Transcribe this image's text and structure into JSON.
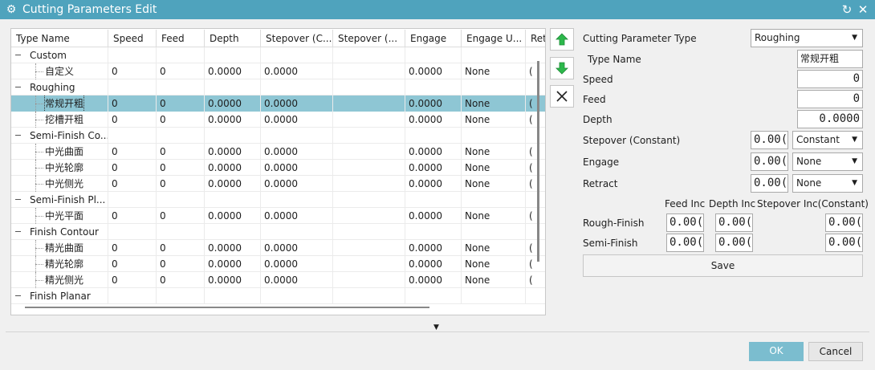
{
  "window": {
    "title": "Cutting Parameters Edit",
    "refresh_glyph": "↻",
    "close_glyph": "✕"
  },
  "colors": {
    "titlebar": "#4fa3bd",
    "selected_row": "#8ec6d4",
    "ok_button": "#7bbdcf",
    "up_arrow": "#2cb84b",
    "down_arrow": "#2cb84b"
  },
  "table": {
    "columns": [
      "Type Name",
      "Speed",
      "Feed",
      "Depth",
      "Stepover (C...",
      "Stepover (...",
      "Engage",
      "Engage U...",
      "Ret"
    ],
    "rows": [
      {
        "level": 0,
        "cells": [
          "Custom",
          "",
          "",
          "",
          "",
          "",
          "",
          "",
          ""
        ]
      },
      {
        "level": 1,
        "cells": [
          "自定义",
          "0",
          "0",
          "0.0000",
          "0.0000",
          "",
          "0.0000",
          "None",
          "("
        ]
      },
      {
        "level": 0,
        "cells": [
          "Roughing",
          "",
          "",
          "",
          "",
          "",
          "",
          "",
          ""
        ]
      },
      {
        "level": 1,
        "selected": true,
        "cells": [
          "常规开粗",
          "0",
          "0",
          "0.0000",
          "0.0000",
          "",
          "0.0000",
          "None",
          "("
        ]
      },
      {
        "level": 1,
        "cells": [
          "挖槽开粗",
          "0",
          "0",
          "0.0000",
          "0.0000",
          "",
          "0.0000",
          "None",
          "("
        ]
      },
      {
        "level": 0,
        "cells": [
          "Semi-Finish Co...",
          "",
          "",
          "",
          "",
          "",
          "",
          "",
          ""
        ]
      },
      {
        "level": 1,
        "cells": [
          "中光曲面",
          "0",
          "0",
          "0.0000",
          "0.0000",
          "",
          "0.0000",
          "None",
          "("
        ]
      },
      {
        "level": 1,
        "cells": [
          "中光轮廓",
          "0",
          "0",
          "0.0000",
          "0.0000",
          "",
          "0.0000",
          "None",
          "("
        ]
      },
      {
        "level": 1,
        "cells": [
          "中光侧光",
          "0",
          "0",
          "0.0000",
          "0.0000",
          "",
          "0.0000",
          "None",
          "("
        ]
      },
      {
        "level": 0,
        "cells": [
          "Semi-Finish Pl...",
          "",
          "",
          "",
          "",
          "",
          "",
          "",
          ""
        ]
      },
      {
        "level": 1,
        "cells": [
          "中光平面",
          "0",
          "0",
          "0.0000",
          "0.0000",
          "",
          "0.0000",
          "None",
          "("
        ]
      },
      {
        "level": 0,
        "cells": [
          "Finish Contour",
          "",
          "",
          "",
          "",
          "",
          "",
          "",
          ""
        ]
      },
      {
        "level": 1,
        "cells": [
          "精光曲面",
          "0",
          "0",
          "0.0000",
          "0.0000",
          "",
          "0.0000",
          "None",
          "("
        ]
      },
      {
        "level": 1,
        "cells": [
          "精光轮廓",
          "0",
          "0",
          "0.0000",
          "0.0000",
          "",
          "0.0000",
          "None",
          "("
        ]
      },
      {
        "level": 1,
        "cells": [
          "精光侧光",
          "0",
          "0",
          "0.0000",
          "0.0000",
          "",
          "0.0000",
          "None",
          "("
        ]
      },
      {
        "level": 0,
        "cells": [
          "Finish Planar",
          "",
          "",
          "",
          "",
          "",
          "",
          "",
          ""
        ]
      }
    ]
  },
  "side_buttons": {
    "move_up_icon": "arrow-up",
    "move_down_icon": "arrow-down",
    "delete_icon": "x"
  },
  "form": {
    "cutting_parameter_type_label": "Cutting Parameter Type",
    "cutting_parameter_type_value": "Roughing",
    "type_name_label": "Type Name",
    "type_name_value": "常规开粗",
    "speed_label": "Speed",
    "speed_value": "0",
    "feed_label": "Feed",
    "feed_value": "0",
    "depth_label": "Depth",
    "depth_value": "0.0000",
    "stepover_label": "Stepover (Constant)",
    "stepover_value": "0.00(",
    "stepover_mode": "Constant",
    "engage_label": "Engage",
    "engage_value": "0.00(",
    "engage_mode": "None",
    "retract_label": "Retract",
    "retract_value": "0.00(",
    "retract_mode": "None",
    "inc_header_feed": "Feed Inc",
    "inc_header_depth": "Depth Inc",
    "inc_header_stepover": "Stepover Inc(Constant)",
    "rough_finish_label": "Rough-Finish",
    "rough_finish_feed": "0.00(",
    "rough_finish_depth": "0.00(",
    "rough_finish_stepover": "0.00(",
    "semi_finish_label": "Semi-Finish",
    "semi_finish_feed": "0.00(",
    "semi_finish_depth": "0.00(",
    "semi_finish_stepover": "0.00(",
    "save_label": "Save"
  },
  "footer": {
    "ok_label": "OK",
    "cancel_label": "Cancel"
  }
}
